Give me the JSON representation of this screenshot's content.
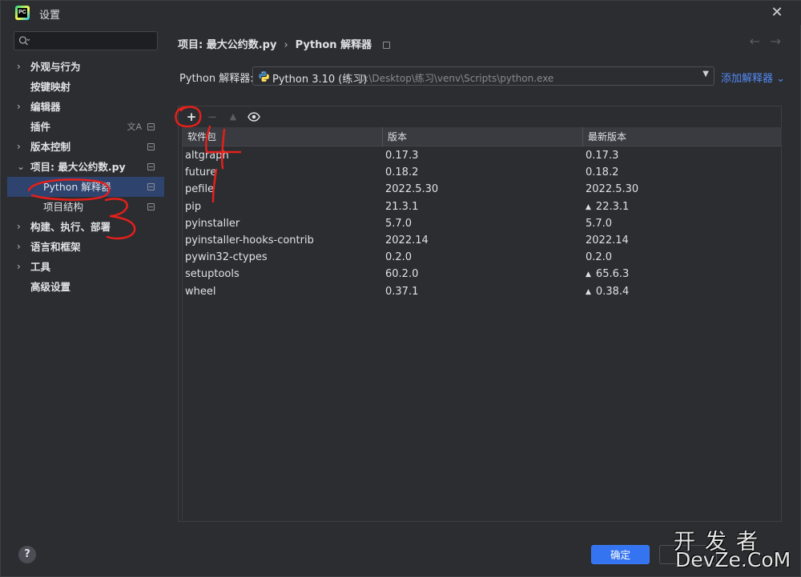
{
  "window": {
    "title": "设置"
  },
  "search": {
    "placeholder": ""
  },
  "sidebar": {
    "items": [
      {
        "label": "外观与行为"
      },
      {
        "label": "按键映射"
      },
      {
        "label": "编辑器"
      },
      {
        "label": "插件"
      },
      {
        "label": "版本控制"
      },
      {
        "label": "项目: 最大公约数.py"
      },
      {
        "label": "Python 解释器"
      },
      {
        "label": "项目结构"
      },
      {
        "label": "构建、执行、部署"
      },
      {
        "label": "语言和框架"
      },
      {
        "label": "工具"
      },
      {
        "label": "高级设置"
      }
    ]
  },
  "breadcrumb": {
    "project": "项目: 最大公约数.py",
    "page": "Python 解释器"
  },
  "interpreter": {
    "label": "Python 解释器:",
    "name": "Python 3.10 (练习)",
    "path": "D:\\Desktop\\练习\\venv\\Scripts\\python.exe",
    "add_label": "添加解释器"
  },
  "table": {
    "headers": [
      "软件包",
      "版本",
      "最新版本"
    ],
    "rows": [
      {
        "name": "altgraph",
        "version": "0.17.3",
        "latest": "0.17.3",
        "upgrade": false
      },
      {
        "name": "future",
        "version": "0.18.2",
        "latest": "0.18.2",
        "upgrade": false
      },
      {
        "name": "pefile",
        "version": "2022.5.30",
        "latest": "2022.5.30",
        "upgrade": false
      },
      {
        "name": "pip",
        "version": "21.3.1",
        "latest": "22.3.1",
        "upgrade": true
      },
      {
        "name": "pyinstaller",
        "version": "5.7.0",
        "latest": "5.7.0",
        "upgrade": false
      },
      {
        "name": "pyinstaller-hooks-contrib",
        "version": "2022.14",
        "latest": "2022.14",
        "upgrade": false
      },
      {
        "name": "pywin32-ctypes",
        "version": "0.2.0",
        "latest": "0.2.0",
        "upgrade": false
      },
      {
        "name": "setuptools",
        "version": "60.2.0",
        "latest": "65.6.3",
        "upgrade": true
      },
      {
        "name": "wheel",
        "version": "0.37.1",
        "latest": "0.38.4",
        "upgrade": true
      }
    ]
  },
  "footer": {
    "ok_label": "确定",
    "cancel_label": "",
    "help_label": "?"
  },
  "watermark": {
    "top": "开发者",
    "bottom": "DevZe.CoM"
  },
  "colors": {
    "accent": "#3574f0",
    "selected": "#2e436e",
    "link": "#548af7",
    "annotation": "#e3201b"
  },
  "icons": [
    "search-icon",
    "chevron-right-icon",
    "chevron-down-icon",
    "plus-icon",
    "minus-icon",
    "upgrade-icon",
    "eye-icon",
    "python-icon",
    "back-arrow-icon",
    "forward-arrow-icon",
    "close-icon",
    "help-icon"
  ]
}
